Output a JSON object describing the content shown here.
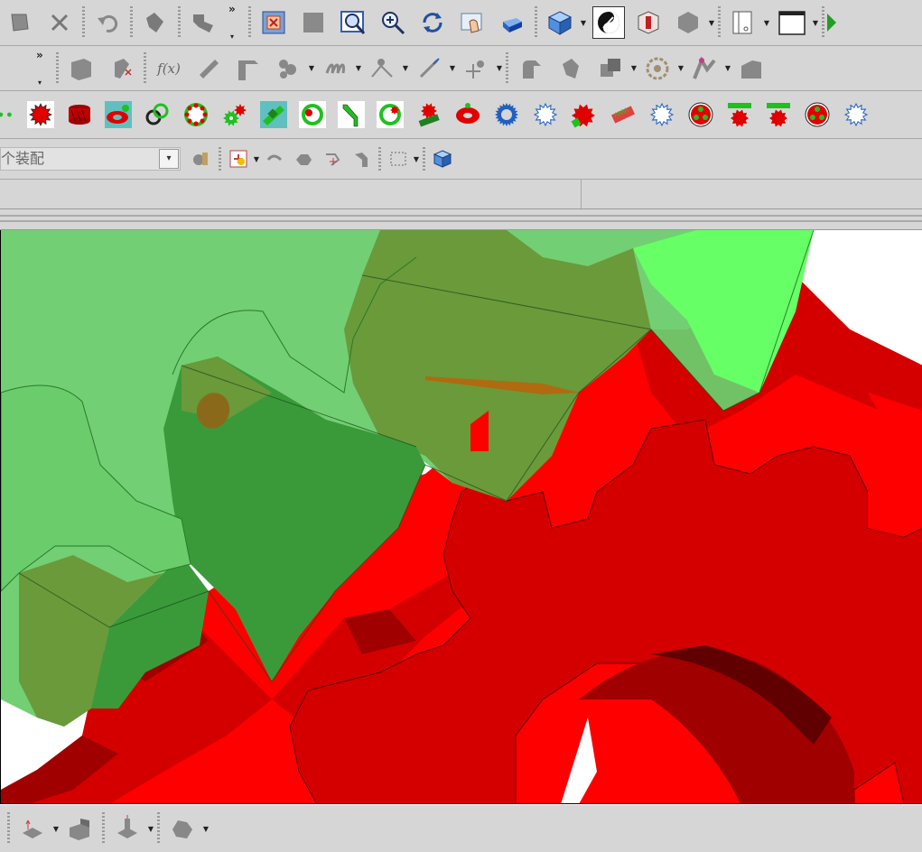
{
  "toolbar1": {
    "more_glyph": "»",
    "more_dropdown_glyph": "▾"
  },
  "toolbar2": {
    "more_glyph": "»",
    "more_dropdown_glyph": "▾",
    "fx_label": "f(x)"
  },
  "toolbar4": {
    "assembly_combo_value": "个装配",
    "combo_arrow_glyph": "▾"
  },
  "viewport": {
    "colors": {
      "gear_red": "#ff0000",
      "gear_red_mid": "#d40000",
      "gear_red_dark": "#a00000",
      "gear_red_darkest": "#600000",
      "gear_green": "#6bcc6b",
      "gear_green_bright": "#66ff66",
      "gear_green_dark": "#3a9a3a",
      "gear_olive": "#6a9a3a"
    }
  },
  "icons": [
    "part-icon",
    "delete-icon",
    "undo-icon",
    "move-face-icon",
    "offset-face-icon",
    "fit-view-icon",
    "shaded-icon",
    "zoom-window-icon",
    "zoom-icon",
    "rotate-icon",
    "pan-icon",
    "perspective-icon",
    "isometric-view-icon",
    "render-style-icon",
    "wireframe-icon",
    "hidden-edge-icon",
    "section-view-icon",
    "new-window-icon",
    "gear-teeth-icon",
    "helical-gear-icon",
    "spur-gear-icon",
    "chain-icon",
    "bearing-icon",
    "sprocket-icon",
    "shaft-icon",
    "ring-gear-icon",
    "spring-icon",
    "worm-gear-icon",
    "rack-icon"
  ]
}
